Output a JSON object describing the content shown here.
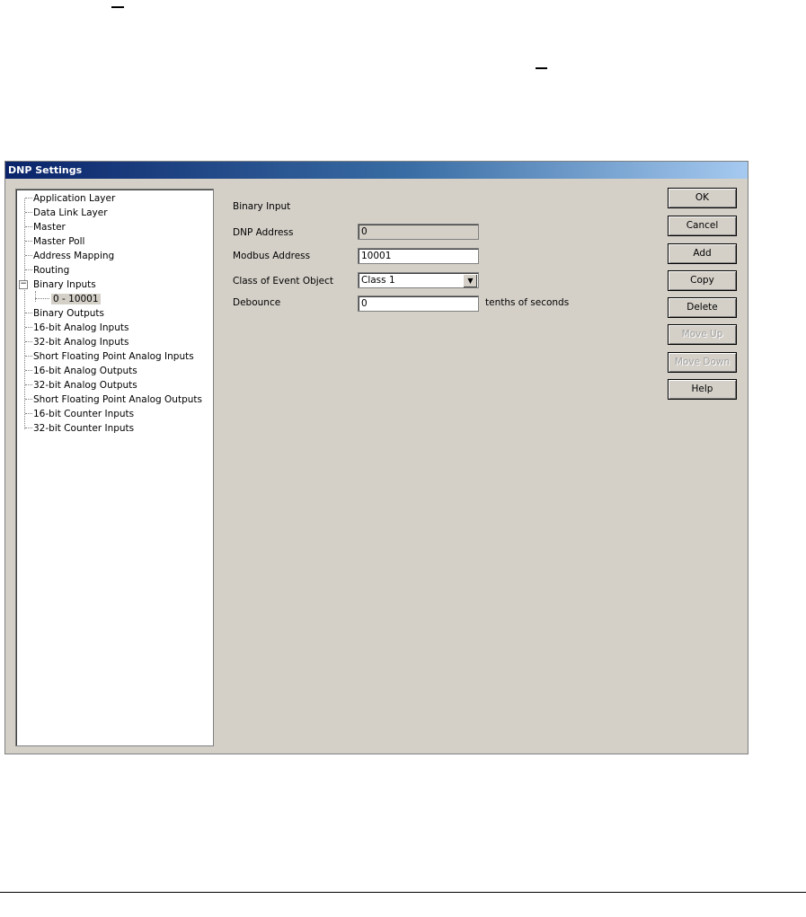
{
  "window": {
    "title": "DNP Settings"
  },
  "tree": {
    "items": [
      {
        "label": "Application Layer"
      },
      {
        "label": "Data Link Layer"
      },
      {
        "label": "Master"
      },
      {
        "label": "Master Poll"
      },
      {
        "label": "Address Mapping"
      },
      {
        "label": "Routing"
      },
      {
        "label": "Binary Inputs",
        "expanded": true,
        "expander": "−"
      },
      {
        "label": "0 - 10001",
        "selected": true,
        "child": true
      },
      {
        "label": "Binary Outputs"
      },
      {
        "label": "16-bit Analog Inputs"
      },
      {
        "label": "32-bit Analog Inputs"
      },
      {
        "label": "Short Floating Point Analog Inputs"
      },
      {
        "label": "16-bit Analog Outputs"
      },
      {
        "label": "32-bit Analog Outputs"
      },
      {
        "label": "Short Floating Point Analog Outputs"
      },
      {
        "label": "16-bit Counter Inputs"
      },
      {
        "label": "32-bit Counter Inputs"
      }
    ]
  },
  "form": {
    "section_title": "Binary Input",
    "dnp_address_label": "DNP Address",
    "dnp_address_value": "0",
    "modbus_address_label": "Modbus Address",
    "modbus_address_value": "10001",
    "class_label": "Class of Event Object",
    "class_value": "Class 1",
    "debounce_label": "Debounce",
    "debounce_value": "0",
    "debounce_unit": "tenths of seconds"
  },
  "buttons": {
    "ok": "OK",
    "cancel": "Cancel",
    "add": "Add",
    "copy": "Copy",
    "delete": "Delete",
    "move_up": "Move Up",
    "move_down": "Move Down",
    "help": "Help"
  },
  "icons": {
    "combo_arrow": "chevron-down-icon",
    "tree_expander": "minus-box-icon"
  }
}
